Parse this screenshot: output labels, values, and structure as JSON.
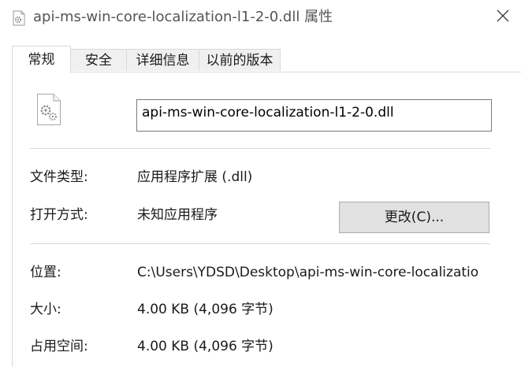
{
  "window": {
    "title": "api-ms-win-core-localization-l1-2-0.dll 属性",
    "title_icon": "dll-file-icon",
    "close_icon": "close-icon"
  },
  "tabs": [
    {
      "label": "常规",
      "active": true
    },
    {
      "label": "安全",
      "active": false
    },
    {
      "label": "详细信息",
      "active": false
    },
    {
      "label": "以前的版本",
      "active": false
    }
  ],
  "general": {
    "file_icon": "dll-file-icon",
    "file_name": "api-ms-win-core-localization-l1-2-0.dll",
    "file_type_label": "文件类型:",
    "file_type_value": "应用程序扩展 (.dll)",
    "opens_with_label": "打开方式:",
    "opens_with_value": "未知应用程序",
    "change_button": "更改(C)...",
    "location_label": "位置:",
    "location_value": "C:\\Users\\YDSD\\Desktop\\api-ms-win-core-localizatio",
    "size_label": "大小:",
    "size_value": "4.00 KB (4,096 字节)",
    "size_on_disk_label": "占用空间:",
    "size_on_disk_value": "4.00 KB (4,096 字节)"
  },
  "colors": {
    "tab_inactive_bg": "#f0f0f0",
    "button_bg": "#e1e1e1",
    "border": "#d9d9d9"
  }
}
